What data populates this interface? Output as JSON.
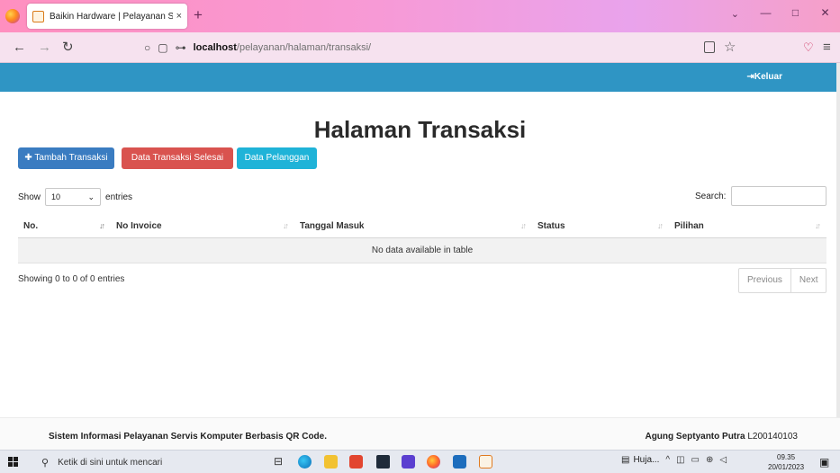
{
  "browser": {
    "tab_title": "Baikin Hardware | Pelayanan Se",
    "tab_close": "×",
    "new_tab": "+",
    "tab_list": "⌄",
    "win_min": "—",
    "win_max": "□",
    "win_close": "✕",
    "url_host": "localhost",
    "url_path": "/pelayanan/halaman/transaksi/"
  },
  "header": {
    "logout_label": "Keluar"
  },
  "page": {
    "title": "Halaman Transaksi",
    "buttons": {
      "add": "Tambah Transaksi",
      "completed": "Data Transaksi Selesai",
      "customers": "Data Pelanggan"
    }
  },
  "table_controls": {
    "show_label": "Show",
    "length_value": "10",
    "entries_label": "entries",
    "search_label": "Search:",
    "search_value": ""
  },
  "table": {
    "columns": [
      "No.",
      "No Invoice",
      "Tanggal Masuk",
      "Status",
      "Pilihan"
    ],
    "empty_message": "No data available in table"
  },
  "info": "Showing 0 to 0 of 0 entries",
  "pagination": {
    "previous": "Previous",
    "next": "Next"
  },
  "footer": {
    "left": "Sistem Informasi Pelayanan Servis Komputer Berbasis QR Code.",
    "author": "Agung Septyanto Putra",
    "nim": "L200140103"
  },
  "taskbar": {
    "search_placeholder": "Ketik di sini untuk mencari",
    "weather": "Huja...",
    "time": "09.35",
    "date": "20/01/2023"
  },
  "colors": {
    "header_bar": "#2f95c4",
    "btn_add": "#3a7cc1",
    "btn_completed": "#d9534f",
    "btn_customers": "#1fb3d8"
  }
}
